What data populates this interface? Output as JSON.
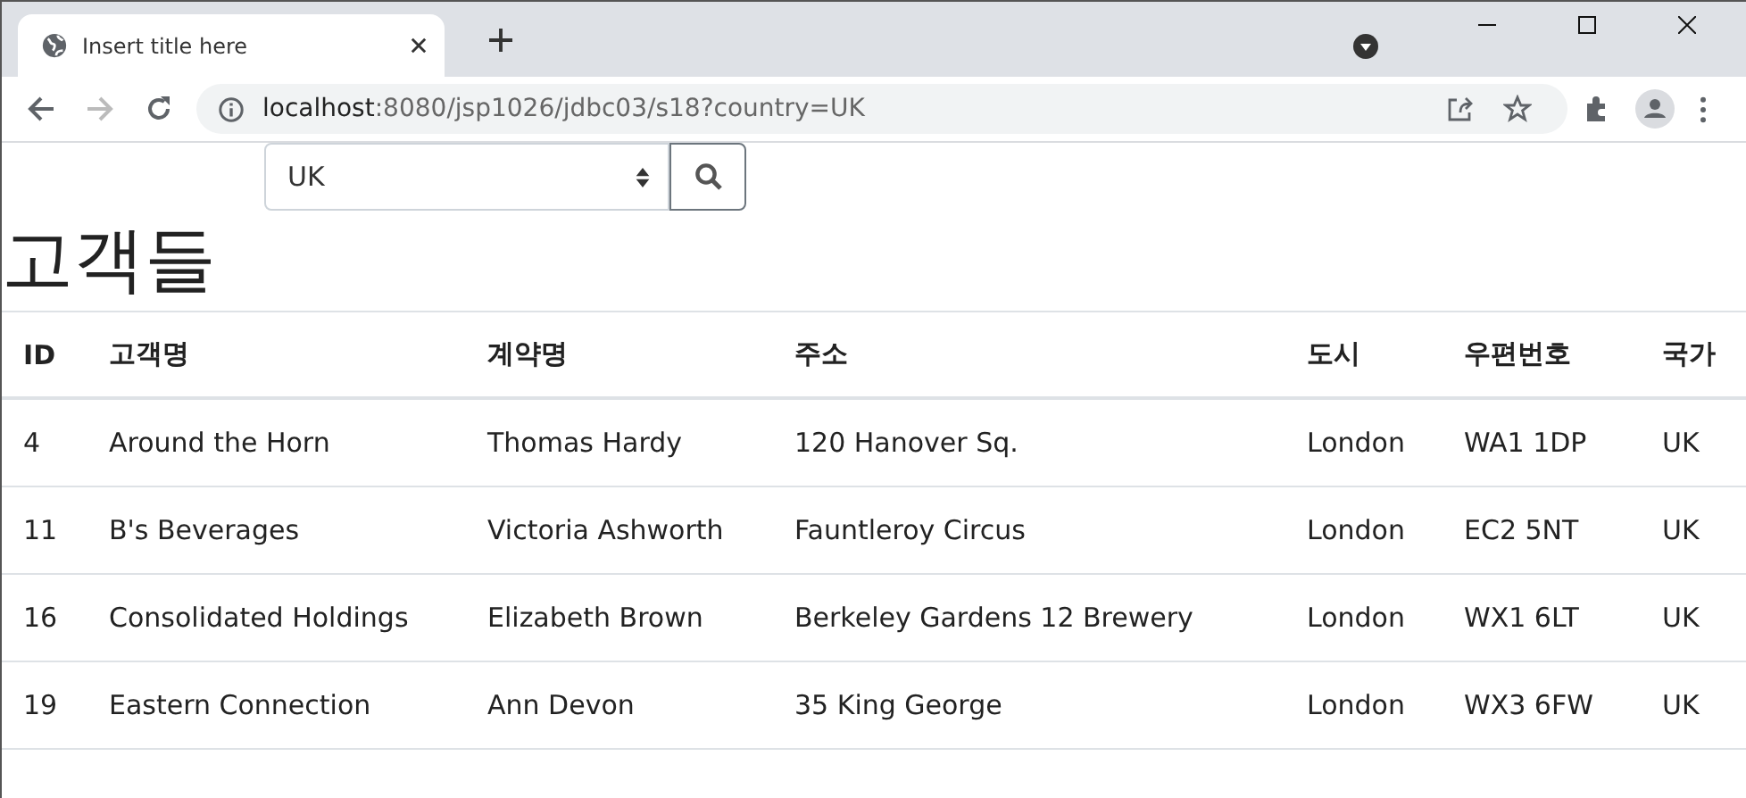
{
  "browser": {
    "tab_title": "Insert title here",
    "url_host": "localhost",
    "url_rest": ":8080/jsp1026/jdbc03/s18?country=UK"
  },
  "search": {
    "country": "UK"
  },
  "heading": "고객들",
  "table": {
    "columns": [
      "ID",
      "고객명",
      "계약명",
      "주소",
      "도시",
      "우편번호",
      "국가"
    ],
    "rows": [
      [
        "4",
        "Around the Horn",
        "Thomas Hardy",
        "120 Hanover Sq.",
        "London",
        "WA1 1DP",
        "UK"
      ],
      [
        "11",
        "B's Beverages",
        "Victoria Ashworth",
        "Fauntleroy Circus",
        "London",
        "EC2 5NT",
        "UK"
      ],
      [
        "16",
        "Consolidated Holdings",
        "Elizabeth Brown",
        "Berkeley Gardens 12 Brewery",
        "London",
        "WX1 6LT",
        "UK"
      ],
      [
        "19",
        "Eastern Connection",
        "Ann Devon",
        "35 King George",
        "London",
        "WX3 6FW",
        "UK"
      ]
    ]
  }
}
